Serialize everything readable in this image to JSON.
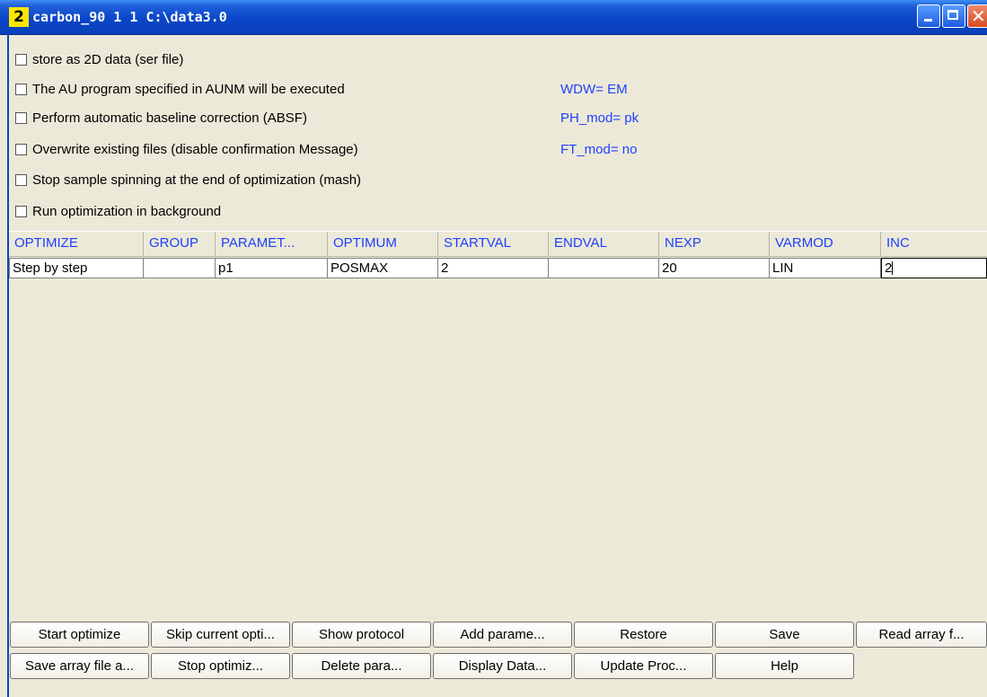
{
  "window": {
    "number_badge": "2",
    "title": "carbon_90  1  1  C:\\data3.0"
  },
  "options": [
    {
      "label": "store as 2D data (ser file)",
      "checked": false
    },
    {
      "label": "The AU program specified in AUNM will be executed",
      "checked": false
    },
    {
      "label": "Perform automatic baseline correction (ABSF)",
      "checked": false
    },
    {
      "label": "Overwrite existing files (disable confirmation Message)",
      "checked": false
    },
    {
      "label": "Stop sample spinning at the end of optimization (mash)",
      "checked": false
    },
    {
      "label": "Run optimization in background",
      "checked": false
    }
  ],
  "status": {
    "wdw": "WDW= EM",
    "ph_mod": "PH_mod= pk",
    "ft_mod": "FT_mod= no"
  },
  "table": {
    "columns": [
      "OPTIMIZE",
      "GROUP",
      "PARAMET...",
      "OPTIMUM",
      "STARTVAL",
      "ENDVAL",
      "NEXP",
      "VARMOD",
      "INC"
    ],
    "rows": [
      [
        "Step by step",
        "",
        "p1",
        "POSMAX",
        "2",
        "",
        "20",
        "LIN",
        "2"
      ]
    ]
  },
  "buttons": {
    "row1": [
      "Start optimize",
      "Skip current opti...",
      "Show protocol",
      "Add parame...",
      "Restore",
      "Save",
      "Read array f..."
    ],
    "row2": [
      "Save array file a...",
      "Stop optimiz...",
      "Delete para...",
      "Display Data...",
      "Update Proc...",
      "Help"
    ]
  },
  "colors": {
    "title_bar": "#0a46c8",
    "header_text": "#1f3fff",
    "background": "#ece9d8"
  }
}
